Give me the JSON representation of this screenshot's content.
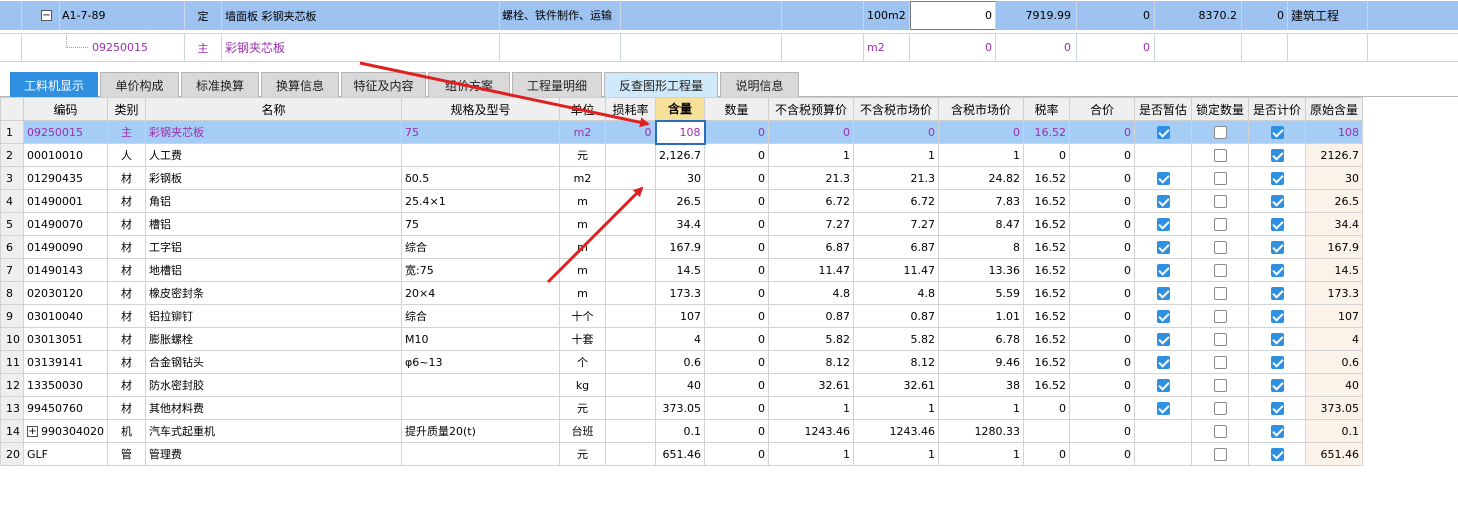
{
  "top": {
    "row1": {
      "expand_glyph": "−",
      "code": "A1-7-89",
      "type": "定",
      "name": "墙面板 彩钢夹芯板",
      "desc": "螺栓、铁件制作、运输",
      "unit": "100m2",
      "qty": "0",
      "v1": "7919.99",
      "v2": "0",
      "v3": "8370.2",
      "v4": "0",
      "category": "建筑工程"
    },
    "row2": {
      "code": "09250015",
      "type": "主",
      "name": "彩钢夹芯板",
      "unit": "m2",
      "qty": "0",
      "v1": "0",
      "v2": "0"
    }
  },
  "tabs": [
    "工料机显示",
    "单价构成",
    "标准换算",
    "换算信息",
    "特征及内容",
    "组价方案",
    "工程量明细",
    "反查图形工程量",
    "说明信息"
  ],
  "headers": [
    "编码",
    "类别",
    "名称",
    "规格及型号",
    "单位",
    "损耗率",
    "含量",
    "数量",
    "不含税预算价",
    "不含税市场价",
    "含税市场价",
    "税率",
    "合价",
    "是否暂估",
    "锁定数量",
    "是否计价",
    "原始含量"
  ],
  "rows": [
    {
      "rn": "1",
      "code": "09250015",
      "cat": "主",
      "name": "彩钢夹芯板",
      "spec": "75",
      "unit": "m2",
      "loss": "0",
      "content": "108",
      "qty": "0",
      "p1": "0",
      "p2": "0",
      "p3": "0",
      "tax": "16.52",
      "total": "0",
      "est": true,
      "lock": false,
      "price": true,
      "orig": "108"
    },
    {
      "rn": "2",
      "code": "00010010",
      "cat": "人",
      "name": "人工费",
      "spec": "",
      "unit": "元",
      "loss": "",
      "content": "2,126.7",
      "qty": "0",
      "p1": "1",
      "p2": "1",
      "p3": "1",
      "tax": "0",
      "total": "0",
      "est": false,
      "lock": false,
      "price": true,
      "orig": "2126.7"
    },
    {
      "rn": "3",
      "code": "01290435",
      "cat": "材",
      "name": "彩钢板",
      "spec": "δ0.5",
      "unit": "m2",
      "loss": "",
      "content": "30",
      "qty": "0",
      "p1": "21.3",
      "p2": "21.3",
      "p3": "24.82",
      "tax": "16.52",
      "total": "0",
      "est": true,
      "lock": false,
      "price": true,
      "orig": "30"
    },
    {
      "rn": "4",
      "code": "01490001",
      "cat": "材",
      "name": "角铝",
      "spec": "25.4×1",
      "unit": "m",
      "loss": "",
      "content": "26.5",
      "qty": "0",
      "p1": "6.72",
      "p2": "6.72",
      "p3": "7.83",
      "tax": "16.52",
      "total": "0",
      "est": true,
      "lock": false,
      "price": true,
      "orig": "26.5"
    },
    {
      "rn": "5",
      "code": "01490070",
      "cat": "材",
      "name": "槽铝",
      "spec": "75",
      "unit": "m",
      "loss": "",
      "content": "34.4",
      "qty": "0",
      "p1": "7.27",
      "p2": "7.27",
      "p3": "8.47",
      "tax": "16.52",
      "total": "0",
      "est": true,
      "lock": false,
      "price": true,
      "orig": "34.4"
    },
    {
      "rn": "6",
      "code": "01490090",
      "cat": "材",
      "name": "工字铝",
      "spec": "综合",
      "unit": "m",
      "loss": "",
      "content": "167.9",
      "qty": "0",
      "p1": "6.87",
      "p2": "6.87",
      "p3": "8",
      "tax": "16.52",
      "total": "0",
      "est": true,
      "lock": false,
      "price": true,
      "orig": "167.9"
    },
    {
      "rn": "7",
      "code": "01490143",
      "cat": "材",
      "name": "地槽铝",
      "spec": "宽:75",
      "unit": "m",
      "loss": "",
      "content": "14.5",
      "qty": "0",
      "p1": "11.47",
      "p2": "11.47",
      "p3": "13.36",
      "tax": "16.52",
      "total": "0",
      "est": true,
      "lock": false,
      "price": true,
      "orig": "14.5"
    },
    {
      "rn": "8",
      "code": "02030120",
      "cat": "材",
      "name": "橡皮密封条",
      "spec": "20×4",
      "unit": "m",
      "loss": "",
      "content": "173.3",
      "qty": "0",
      "p1": "4.8",
      "p2": "4.8",
      "p3": "5.59",
      "tax": "16.52",
      "total": "0",
      "est": true,
      "lock": false,
      "price": true,
      "orig": "173.3"
    },
    {
      "rn": "9",
      "code": "03010040",
      "cat": "材",
      "name": "铝拉铆钉",
      "spec": "综合",
      "unit": "十个",
      "loss": "",
      "content": "107",
      "qty": "0",
      "p1": "0.87",
      "p2": "0.87",
      "p3": "1.01",
      "tax": "16.52",
      "total": "0",
      "est": true,
      "lock": false,
      "price": true,
      "orig": "107"
    },
    {
      "rn": "10",
      "code": "03013051",
      "cat": "材",
      "name": "膨胀螺栓",
      "spec": "M10",
      "unit": "十套",
      "loss": "",
      "content": "4",
      "qty": "0",
      "p1": "5.82",
      "p2": "5.82",
      "p3": "6.78",
      "tax": "16.52",
      "total": "0",
      "est": true,
      "lock": false,
      "price": true,
      "orig": "4"
    },
    {
      "rn": "11",
      "code": "03139141",
      "cat": "材",
      "name": "合金钢钻头",
      "spec": "φ6~13",
      "unit": "个",
      "loss": "",
      "content": "0.6",
      "qty": "0",
      "p1": "8.12",
      "p2": "8.12",
      "p3": "9.46",
      "tax": "16.52",
      "total": "0",
      "est": true,
      "lock": false,
      "price": true,
      "orig": "0.6"
    },
    {
      "rn": "12",
      "code": "13350030",
      "cat": "材",
      "name": "防水密封胶",
      "spec": "",
      "unit": "kg",
      "loss": "",
      "content": "40",
      "qty": "0",
      "p1": "32.61",
      "p2": "32.61",
      "p3": "38",
      "tax": "16.52",
      "total": "0",
      "est": true,
      "lock": false,
      "price": true,
      "orig": "40"
    },
    {
      "rn": "13",
      "code": "99450760",
      "cat": "材",
      "name": "其他材料费",
      "spec": "",
      "unit": "元",
      "loss": "",
      "content": "373.05",
      "qty": "0",
      "p1": "1",
      "p2": "1",
      "p3": "1",
      "tax": "0",
      "total": "0",
      "est": true,
      "lock": false,
      "price": true,
      "orig": "373.05"
    },
    {
      "rn": "14",
      "code": "990304020",
      "cat": "机",
      "name": "汽车式起重机",
      "spec": "提升质量20(t)",
      "unit": "台班",
      "loss": "",
      "content": "0.1",
      "qty": "0",
      "p1": "1243.46",
      "p2": "1243.46",
      "p3": "1280.33",
      "tax": "",
      "total": "0",
      "est": false,
      "lock": false,
      "price": true,
      "orig": "0.1",
      "expandable": true
    },
    {
      "rn": "20",
      "code": "GLF",
      "cat": "管",
      "name": "管理费",
      "spec": "",
      "unit": "元",
      "loss": "",
      "content": "651.46",
      "qty": "0",
      "p1": "1",
      "p2": "1",
      "p3": "1",
      "tax": "0",
      "total": "0",
      "est": false,
      "lock": false,
      "price": true,
      "orig": "651.46"
    }
  ],
  "colors": {
    "selected_row": "#a6cdf5",
    "accent": "#2f8fe0",
    "highlight_header": "#f7e09a",
    "arrow": "#e02020"
  }
}
